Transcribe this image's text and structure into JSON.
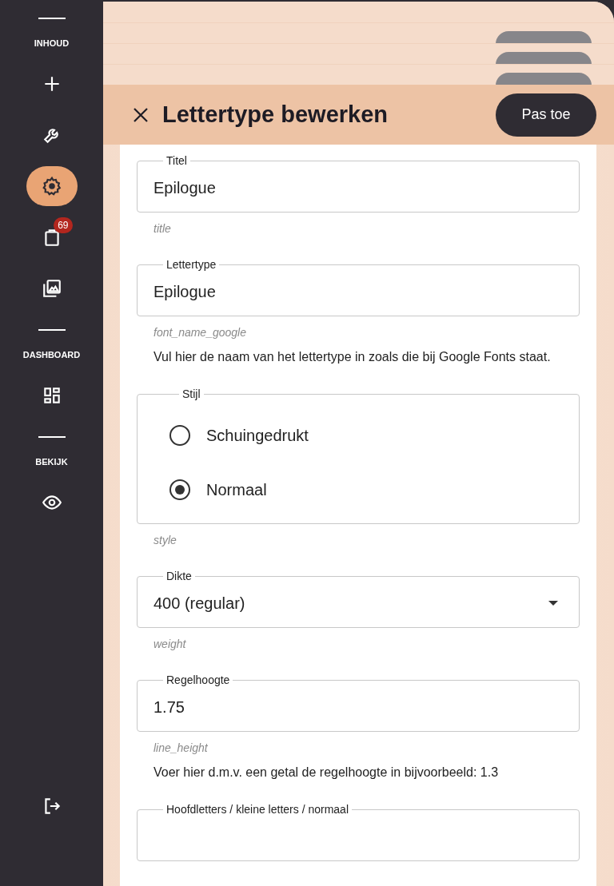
{
  "sidebar": {
    "sections": [
      {
        "label": "INHOUD",
        "items": [
          {
            "selected": false
          },
          {
            "selected": false
          },
          {
            "selected": true
          },
          {
            "selected": false,
            "badge": "69"
          },
          {
            "selected": false
          }
        ]
      },
      {
        "label": "DASHBOARD",
        "items": [
          {
            "selected": false
          }
        ]
      },
      {
        "label": "BEKIJK",
        "items": [
          {
            "selected": false
          }
        ]
      }
    ]
  },
  "dialog": {
    "title": "Lettertype bewerken",
    "apply_button": "Pas toe"
  },
  "fields": [
    {
      "kind": "text",
      "label": "Titel",
      "value": "Epilogue",
      "key": "title"
    },
    {
      "kind": "text",
      "label": "Lettertype",
      "value": "Epilogue",
      "key": "font_name_google",
      "description": "Vul hier de naam van het lettertype in zoals die bij Google Fonts staat."
    },
    {
      "kind": "radio",
      "label": "Stijl",
      "options": [
        {
          "label": "Schuingedrukt",
          "selected": false
        },
        {
          "label": "Normaal",
          "selected": true
        }
      ],
      "key": "style"
    },
    {
      "kind": "select",
      "label": "Dikte",
      "value": "400 (regular)",
      "key": "weight"
    },
    {
      "kind": "text",
      "label": "Regelhoogte",
      "value": "1.75",
      "key": "line_height",
      "description": "Voer hier d.m.v. een getal de regelhoogte in bijvoorbeeld: 1.3"
    },
    {
      "kind": "text",
      "label": "Hoofdletters / kleine letters / normaal"
    }
  ]
}
